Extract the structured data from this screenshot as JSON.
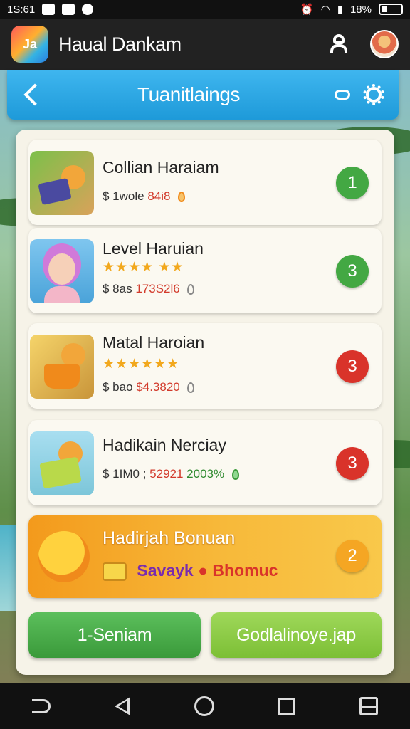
{
  "status_bar": {
    "time": "1S:61",
    "battery": "18%"
  },
  "app_bar": {
    "logo_text": "Ja",
    "title": "Haual Dankam"
  },
  "header": {
    "title": "Tuanitlaings"
  },
  "cards": [
    {
      "title": "Collian Haraiam",
      "meta_prefix": "$ 1wole",
      "meta_value": "84i8",
      "badge": "1",
      "badge_color": "#43a843"
    },
    {
      "title": "Level Haruian",
      "stars": "★★★★ ★★",
      "meta_prefix": "$ 8as",
      "meta_value": "173S2l6",
      "badge": "3",
      "badge_color": "#43a843"
    },
    {
      "title": "Matal Haroian",
      "stars": "★★★★★★",
      "meta_prefix": "$ bao",
      "meta_value": "$4.3820",
      "badge": "3",
      "badge_color": "#d9332a"
    },
    {
      "title": "Hadikain Nerciay",
      "meta_prefix": "$ 1IM0 ;",
      "meta_value": "52921",
      "meta_extra": "2003%",
      "badge": "3",
      "badge_color": "#d9332a"
    }
  ],
  "bonus": {
    "title": "Hadirjah Bonuan",
    "sub_left": "Savayk",
    "sub_right": "Bhomuc",
    "badge": "2",
    "badge_color": "#f5a623"
  },
  "buttons": {
    "left": "1-Seniam",
    "right": "Godlalinoye.jap"
  },
  "colors": {
    "header_blue": "#1e9ad9",
    "panel_bg": "#f6f3e8",
    "button_green": "#3a9a3a",
    "button_lime": "#7cbf35"
  }
}
